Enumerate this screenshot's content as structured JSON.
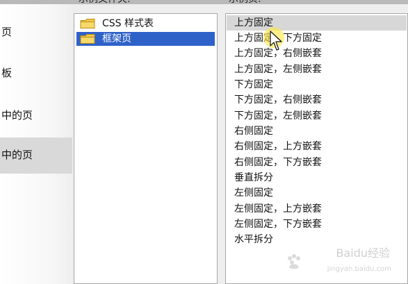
{
  "left_panel": {
    "items": [
      {
        "label": "页"
      },
      {
        "label": "板"
      },
      {
        "label": "中的页"
      },
      {
        "label": "中的页"
      }
    ]
  },
  "labels": {
    "folders": "示例文件夹:",
    "pages": "示例页:"
  },
  "folders": [
    {
      "label": "CSS 样式表",
      "icon": "folder-icon"
    },
    {
      "label": "框架页",
      "icon": "folder-icon"
    }
  ],
  "pages": [
    {
      "label": "上方固定"
    },
    {
      "label": "上方固定，下方固定"
    },
    {
      "label": "上方固定，右侧嵌套"
    },
    {
      "label": "上方固定，左侧嵌套"
    },
    {
      "label": "下方固定"
    },
    {
      "label": "下方固定，右侧嵌套"
    },
    {
      "label": "下方固定，左侧嵌套"
    },
    {
      "label": "右侧固定"
    },
    {
      "label": "右侧固定，上方嵌套"
    },
    {
      "label": "右侧固定，下方嵌套"
    },
    {
      "label": "垂直拆分"
    },
    {
      "label": "左侧固定"
    },
    {
      "label": "左侧固定，上方嵌套"
    },
    {
      "label": "左侧固定，下方嵌套"
    },
    {
      "label": "水平拆分"
    }
  ],
  "watermark": {
    "main": "Baidu经验",
    "sub": "jingyan.baidu.com"
  },
  "colors": {
    "selection_blue": "#2f62c9",
    "selection_gray": "#d7d7d7",
    "panel_border": "#a6a6a6"
  }
}
